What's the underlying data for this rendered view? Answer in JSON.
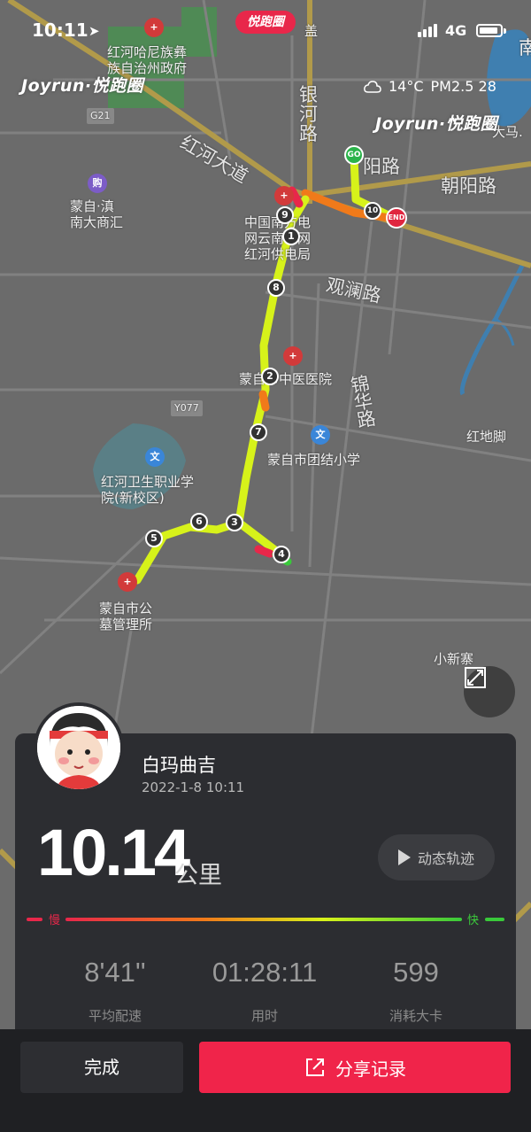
{
  "status_bar": {
    "time": "10:11",
    "network": "4G"
  },
  "brand": {
    "tag": "悦跑圈",
    "logo_left": "Joyrun·悦跑圈",
    "logo_right": "Joyrun·悦跑圈"
  },
  "weather": {
    "temperature": "14°C",
    "air_quality": "PM2.5 28"
  },
  "map": {
    "labels": {
      "gov": "红河哈尼族彝\n族自治州政府",
      "g21": "G21",
      "honghe_ave": "红河大道",
      "yinhe_rd": "银\n河\n路",
      "mengzi_mall": "蒙自·滇\n南大商汇",
      "chaoyang_rd": "朝阳路",
      "yang_rd": "阳路",
      "power_bureau": "中国南方电\n网云南电网\n红河供电局",
      "guanlan_rd": "观澜路",
      "tcm_hospital": "蒙自市中医医院",
      "jinhua_rd": "锦\n华\n路",
      "y077": "Y077",
      "hongdijiao": "红地脚",
      "tuanjie_school": "蒙自市团结小学",
      "health_college": "红河卫生职业学\n院(新校区)",
      "cemetery": "蒙自市公\n墓管理所",
      "xiaoxinzhai": "小新寨",
      "dama": "大马.",
      "top_gai": "盖",
      "top_n": "南"
    },
    "markers": {
      "start": "GO",
      "end": "END",
      "km": [
        "1",
        "2",
        "3",
        "4",
        "5",
        "6",
        "7",
        "8",
        "9",
        "10"
      ]
    },
    "poi_icon_text": {
      "hospital": "+",
      "school": "文",
      "shopping": "购"
    }
  },
  "record": {
    "username": "白玛曲吉",
    "datetime": "2022-1-8 10:11",
    "distance": "10.14",
    "unit": "公里",
    "replay_label": "动态轨迹",
    "pace_slow": "慢",
    "pace_fast": "快",
    "stats": [
      {
        "value": "8'41''",
        "label": "平均配速"
      },
      {
        "value": "01:28:11",
        "label": "用时"
      },
      {
        "value": "599",
        "label": "消耗大卡"
      }
    ]
  },
  "actions": {
    "done": "完成",
    "share": "分享记录"
  },
  "colors": {
    "accent": "#f0244a",
    "route_main": "#d7f21a",
    "route_fast": "#39c93a",
    "panel": "#2c2d31",
    "road": "#b19a4a"
  },
  "icons": [
    "location-arrow-icon",
    "signal-icon",
    "battery-icon",
    "cloud-icon",
    "hospital-icon",
    "school-icon",
    "expand-icon",
    "play-icon",
    "share-icon"
  ]
}
